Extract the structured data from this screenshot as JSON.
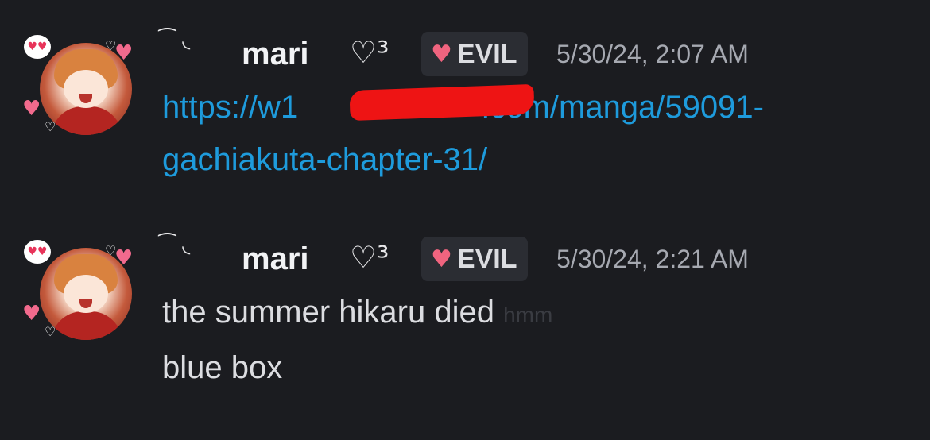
{
  "messages": [
    {
      "username": "mari",
      "prefix": "⁀ ◟",
      "user_deco": "♡³",
      "tag": {
        "icon": "heart-icon",
        "label": "EVIL"
      },
      "timestamp": "5/30/24, 2:07 AM",
      "link_line1_start": "https://w1",
      "link_line1_end": ".com/manga/59091-",
      "link_line2": "gachiakuta-chapter-31/"
    },
    {
      "username": "mari",
      "prefix": "⁀ ◟",
      "user_deco": "♡³",
      "tag": {
        "icon": "heart-icon",
        "label": "EVIL"
      },
      "timestamp": "5/30/24, 2:21 AM",
      "line1": "the summer hikaru died",
      "line1_faded": "hmm",
      "line2": "blue box"
    }
  ],
  "colors": {
    "background": "#1b1c20",
    "link": "#1e9bdc",
    "tag_bg": "#2b2d33",
    "redaction": "#ee1414"
  }
}
